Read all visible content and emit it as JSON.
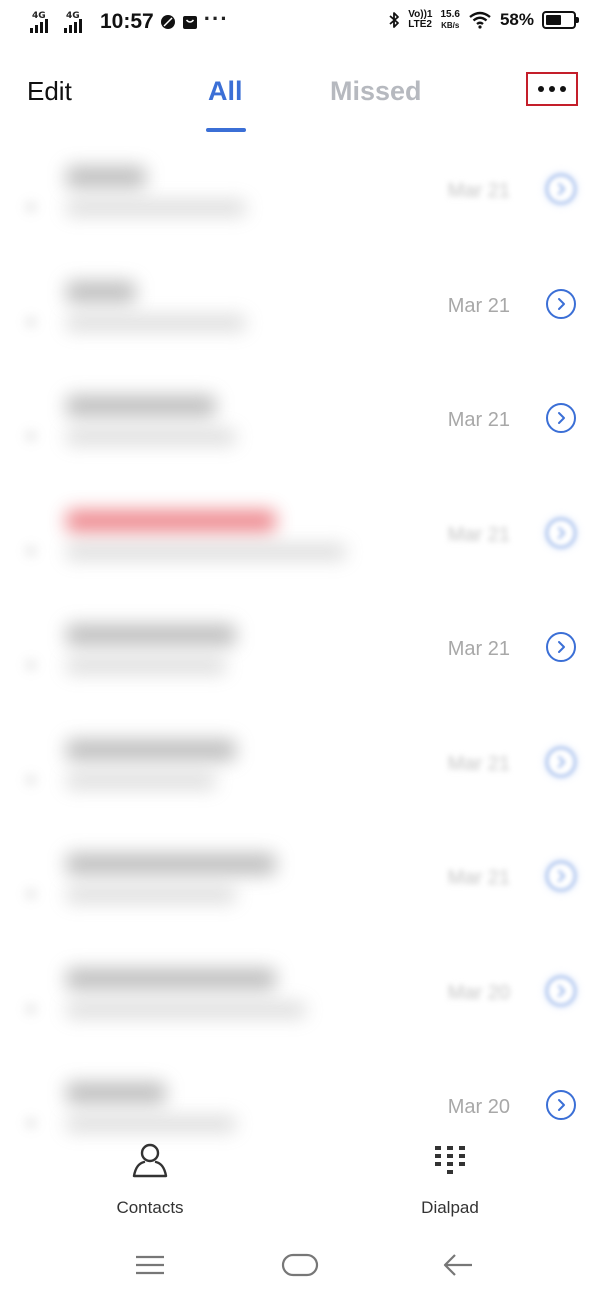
{
  "status_bar": {
    "network_1": "4G",
    "network_2": "4G",
    "time": "10:57",
    "overflow": "···",
    "volte_top": "Vo))1",
    "volte_bottom": "LTE2",
    "speed_value": "15.6",
    "speed_unit": "KB/s",
    "battery_percent": "58%",
    "battery_level": 0.58
  },
  "header": {
    "edit_label": "Edit",
    "tab_all_label": "All",
    "tab_missed_label": "Missed",
    "more_icon": "more-horizontal-icon"
  },
  "call_log": [
    {
      "date": "Mar 21",
      "missed": false,
      "soft": true
    },
    {
      "date": "Mar 21",
      "missed": false,
      "soft": false
    },
    {
      "date": "Mar 21",
      "missed": false,
      "soft": false
    },
    {
      "date": "Mar 21",
      "missed": true,
      "soft": true
    },
    {
      "date": "Mar 21",
      "missed": false,
      "soft": false
    },
    {
      "date": "Mar 21",
      "missed": false,
      "soft": true
    },
    {
      "date": "Mar 21",
      "missed": false,
      "soft": true
    },
    {
      "date": "Mar 20",
      "missed": false,
      "soft": true
    },
    {
      "date": "Mar 20",
      "missed": false,
      "soft": false
    }
  ],
  "bottom_nav": {
    "contacts_label": "Contacts",
    "dialpad_label": "Dialpad"
  },
  "colors": {
    "accent": "#3b6fd6",
    "inactive_tab": "#b6b9bf",
    "highlight_box": "#c41e2a",
    "date_text": "#a8a8a8"
  }
}
